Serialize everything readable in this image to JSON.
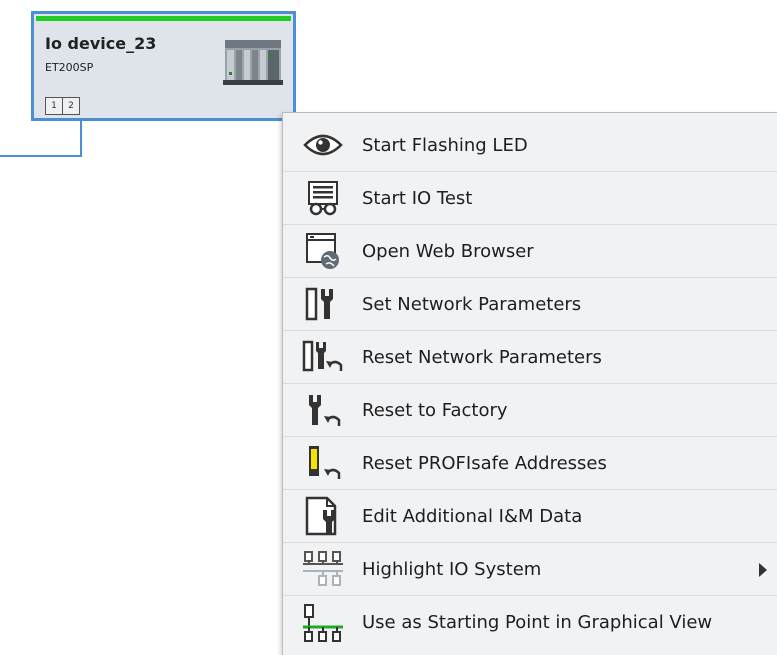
{
  "device": {
    "name": "Io device_23",
    "type": "ET200SP",
    "ports": [
      "1",
      "2"
    ],
    "status_color": "#22cc22",
    "border_color": "#4d8fd6"
  },
  "menu": {
    "items": [
      {
        "label": "Start Flashing LED",
        "icon": "eye-icon"
      },
      {
        "label": "Start IO Test",
        "icon": "io-test-icon"
      },
      {
        "label": "Open Web Browser",
        "icon": "web-browser-icon"
      },
      {
        "label": "Set Network Parameters",
        "icon": "set-network-parameters-icon"
      },
      {
        "label": "Reset Network Parameters",
        "icon": "reset-network-parameters-icon"
      },
      {
        "label": "Reset to Factory",
        "icon": "reset-factory-icon"
      },
      {
        "label": "Reset PROFIsafe Addresses",
        "icon": "reset-profisafe-icon"
      },
      {
        "label": "Edit Additional I&M Data",
        "icon": "edit-im-data-icon"
      },
      {
        "label": "Highlight IO System",
        "icon": "highlight-io-system-icon",
        "submenu": true
      },
      {
        "label": "Use as Starting Point in Graphical View",
        "icon": "starting-point-icon"
      }
    ]
  }
}
